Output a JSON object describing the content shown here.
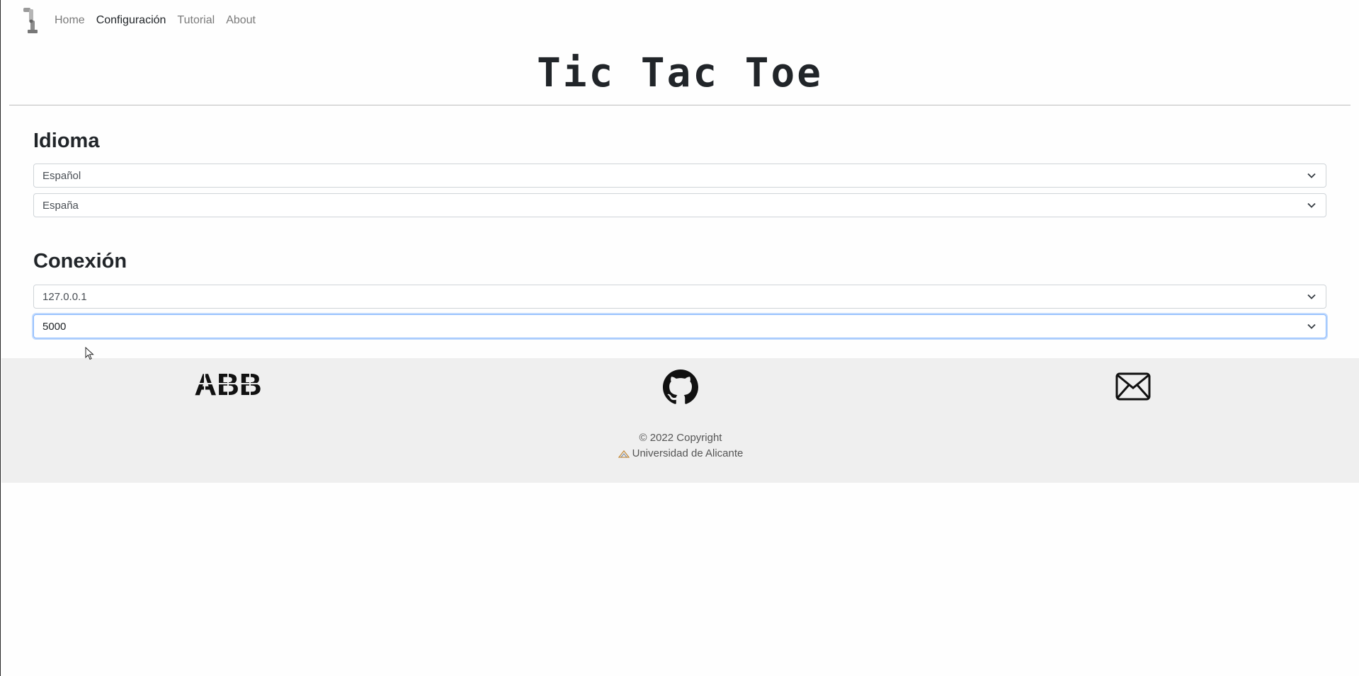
{
  "nav": {
    "items": [
      {
        "label": "Home",
        "active": false
      },
      {
        "label": "Configuración",
        "active": true
      },
      {
        "label": "Tutorial",
        "active": false
      },
      {
        "label": "About",
        "active": false
      }
    ]
  },
  "header": {
    "title": "Tic Tac Toe"
  },
  "idioma": {
    "heading": "Idioma",
    "language_value": "Español",
    "region_value": "España"
  },
  "conexion": {
    "heading": "Conexión",
    "host_value": "127.0.0.1",
    "port_value": "5000"
  },
  "footer": {
    "abb_logo_text": "ABB",
    "icons": [
      "abb-logo",
      "github-icon",
      "mail-icon"
    ],
    "copyright": "© 2022 Copyright",
    "university": "Universidad de Alicante"
  },
  "colors": {
    "footer_bg": "#efefef",
    "focus_border": "#86b7fe",
    "text": "#212529"
  }
}
